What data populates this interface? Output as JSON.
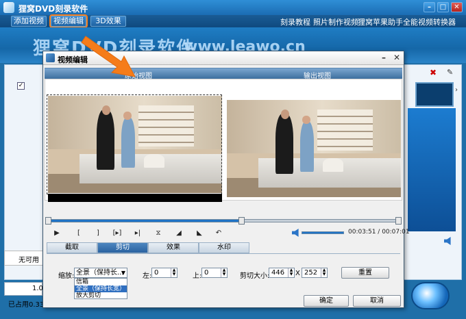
{
  "app": {
    "title": "狸窝DVD刻录软件",
    "banner_brand": "狸窝DVD刻录软件",
    "banner_url": "www.leawo.cn"
  },
  "menu": {
    "add_video": "添加视频",
    "edit_video": "视频编辑",
    "effect_3d": "3D效果",
    "links": [
      "刻录教程",
      "照片制作视频",
      "狸窝苹果助手",
      "全能视频转换器"
    ]
  },
  "main": {
    "unused_label": "无可用",
    "progress_text": "1.0",
    "used_label": "已占用0.33"
  },
  "dialog": {
    "title": "视频编辑",
    "left_view": "原始视图",
    "right_view": "输出视图",
    "time_current": "00:03:51",
    "time_total": "00:07:01",
    "tabs": [
      "截取",
      "剪切",
      "效果",
      "水印"
    ],
    "active_tab": "剪切",
    "zoom_label": "缩放:",
    "zoom_value": "全景（保持长...",
    "zoom_options": [
      "信箱",
      "全景（保持长宽）",
      "放大剪切"
    ],
    "left_label": "左:",
    "left_value": "0",
    "top_label": "上:",
    "top_value": "0",
    "crop_size_label": "剪切大小:",
    "crop_w": "446",
    "crop_x": "X",
    "crop_h": "252",
    "reset": "重置",
    "ok": "确定",
    "cancel": "取消",
    "playback_progress": 0.55
  },
  "colors": {
    "accent": "#1f73c6",
    "highlight": "#f57c1a"
  }
}
